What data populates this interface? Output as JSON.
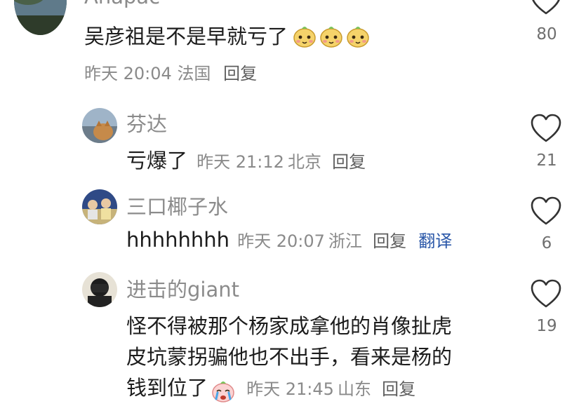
{
  "comments": [
    {
      "username": "Anapac",
      "text": "吴彦祖是不是早就亏了",
      "emoji": [
        "pear-face-emoji",
        "pear-face-emoji",
        "pear-face-emoji"
      ],
      "time": "昨天 20:04",
      "location": "法国",
      "reply_label": "回复",
      "likes": "80"
    },
    {
      "username": "芬达",
      "text": "亏爆了",
      "time": "昨天 21:12",
      "location": "北京",
      "reply_label": "回复",
      "likes": "21"
    },
    {
      "username": "三口椰子水",
      "text": "hhhhhhhh",
      "time": "昨天 20:07",
      "location": "浙江",
      "reply_label": "回复",
      "translate_label": "翻译",
      "likes": "6"
    },
    {
      "username": "进击的giant",
      "text_line1": "怪不得被那个杨家成拿他的肖像扯虎",
      "text_line2": "皮坑蒙拐骗他也不出手，看来是杨的",
      "text_line3": "钱到位了",
      "emoji": [
        "crying-pear-emoji"
      ],
      "time": "昨天 21:45",
      "location": "山东",
      "reply_label": "回复",
      "likes": "19"
    }
  ],
  "icons": {
    "like": "heart-outline-icon"
  },
  "colors": {
    "meta": "#8a8a8a",
    "translate": "#2a57a8",
    "username": "#8b8b8b"
  }
}
